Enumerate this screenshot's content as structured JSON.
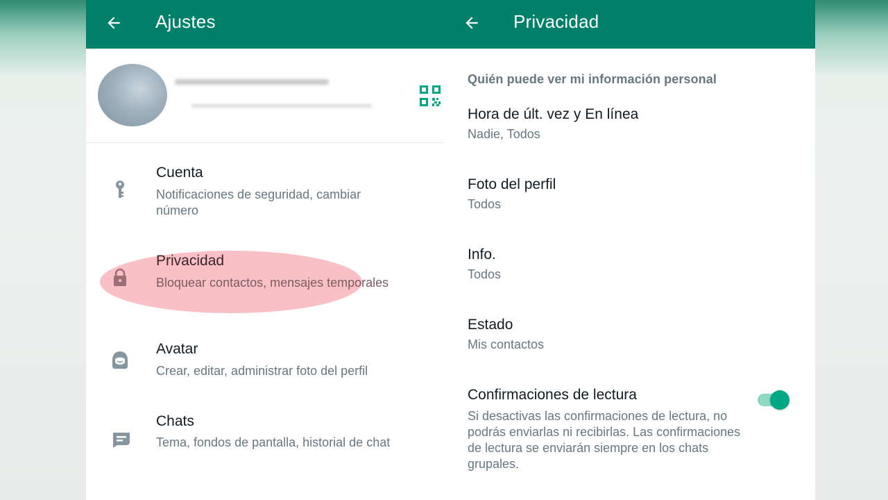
{
  "colors": {
    "brand": "#008069",
    "accent": "#00a884",
    "highlight": "#f4828c"
  },
  "left": {
    "header": {
      "title": "Ajustes",
      "back_icon": "arrow-left-icon"
    },
    "profile": {
      "qr_icon": "qr-code-icon"
    },
    "items": [
      {
        "icon": "key-icon",
        "title": "Cuenta",
        "subtitle": "Notificaciones de seguridad, cambiar número"
      },
      {
        "icon": "lock-icon",
        "title": "Privacidad",
        "subtitle": "Bloquear contactos, mensajes temporales"
      },
      {
        "icon": "avatar-icon",
        "title": "Avatar",
        "subtitle": "Crear, editar, administrar foto del perfil"
      },
      {
        "icon": "chat-icon",
        "title": "Chats",
        "subtitle": "Tema, fondos de pantalla, historial de chat"
      }
    ]
  },
  "right": {
    "header": {
      "title": "Privacidad",
      "back_icon": "arrow-left-icon"
    },
    "section_title": "Quién puede ver mi información personal",
    "settings": [
      {
        "title": "Hora de últ. vez y En línea",
        "value": "Nadie, Todos"
      },
      {
        "title": "Foto del perfil",
        "value": "Todos"
      },
      {
        "title": "Info.",
        "value": "Todos"
      },
      {
        "title": "Estado",
        "value": "Mis contactos"
      }
    ],
    "read_receipts": {
      "title": "Confirmaciones de lectura",
      "description": "Si desactivas las confirmaciones de lectura, no podrás enviarlas ni recibirlas. Las confirmaciones de lectura se enviarán siempre en los chats grupales.",
      "enabled": true
    }
  }
}
